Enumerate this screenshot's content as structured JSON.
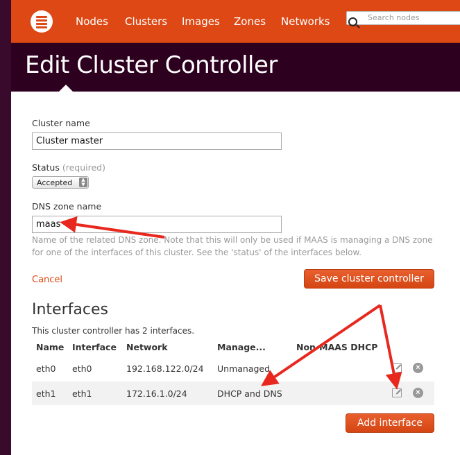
{
  "nav": {
    "items": [
      "Nodes",
      "Clusters",
      "Images",
      "Zones",
      "Networks"
    ],
    "search_placeholder": "Search nodes"
  },
  "page": {
    "title": "Edit Cluster Controller"
  },
  "form": {
    "cluster_name_label": "Cluster name",
    "cluster_name_value": "Cluster master",
    "status_label": "Status",
    "status_required": "(required)",
    "status_value": "Accepted",
    "dns_label": "DNS zone name",
    "dns_value": "maas",
    "dns_help": "Name of the related DNS zone. Note that this will only be used if MAAS is managing a DNS zone for one of the interfaces of this cluster. See the 'status' of the interfaces below.",
    "cancel_label": "Cancel",
    "save_label": "Save cluster controller"
  },
  "interfaces": {
    "heading": "Interfaces",
    "count_text": "This cluster controller has 2 interfaces.",
    "columns": [
      "Name",
      "Interface",
      "Network",
      "Manage...",
      "Non-MAAS DHCP"
    ],
    "rows": [
      {
        "name": "eth0",
        "interface": "eth0",
        "network": "192.168.122.0/24",
        "management": "Unmanaged"
      },
      {
        "name": "eth1",
        "interface": "eth1",
        "network": "172.16.1.0/24",
        "management": "DHCP and DNS"
      }
    ],
    "add_label": "Add interface"
  },
  "colors": {
    "accent": "#dd4814",
    "header_bg": "#2c001e",
    "annotation": "#e8281e"
  }
}
